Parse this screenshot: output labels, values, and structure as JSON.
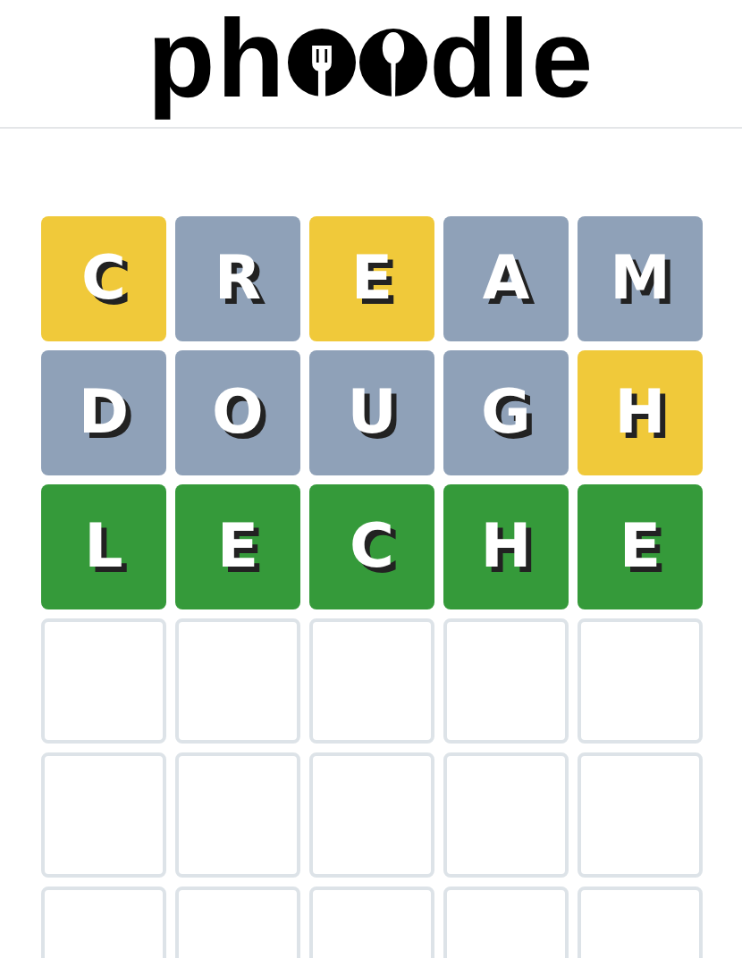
{
  "logo": {
    "text_before": "ph",
    "text_after": "dle"
  },
  "board": [
    [
      {
        "letter": "C",
        "kind": "present"
      },
      {
        "letter": "R",
        "kind": "absent"
      },
      {
        "letter": "E",
        "kind": "present"
      },
      {
        "letter": "A",
        "kind": "absent"
      },
      {
        "letter": "M",
        "kind": "absent"
      }
    ],
    [
      {
        "letter": "D",
        "kind": "absent"
      },
      {
        "letter": "O",
        "kind": "absent"
      },
      {
        "letter": "U",
        "kind": "absent"
      },
      {
        "letter": "G",
        "kind": "absent"
      },
      {
        "letter": "H",
        "kind": "present"
      }
    ],
    [
      {
        "letter": "L",
        "kind": "correct"
      },
      {
        "letter": "E",
        "kind": "correct"
      },
      {
        "letter": "C",
        "kind": "correct"
      },
      {
        "letter": "H",
        "kind": "correct"
      },
      {
        "letter": "E",
        "kind": "correct"
      }
    ],
    [
      {
        "kind": "empty"
      },
      {
        "kind": "empty"
      },
      {
        "kind": "empty"
      },
      {
        "kind": "empty"
      },
      {
        "kind": "empty"
      }
    ],
    [
      {
        "kind": "empty"
      },
      {
        "kind": "empty"
      },
      {
        "kind": "empty"
      },
      {
        "kind": "empty"
      },
      {
        "kind": "empty"
      }
    ],
    [
      {
        "kind": "empty"
      },
      {
        "kind": "empty"
      },
      {
        "kind": "empty"
      },
      {
        "kind": "empty"
      },
      {
        "kind": "empty"
      }
    ]
  ]
}
